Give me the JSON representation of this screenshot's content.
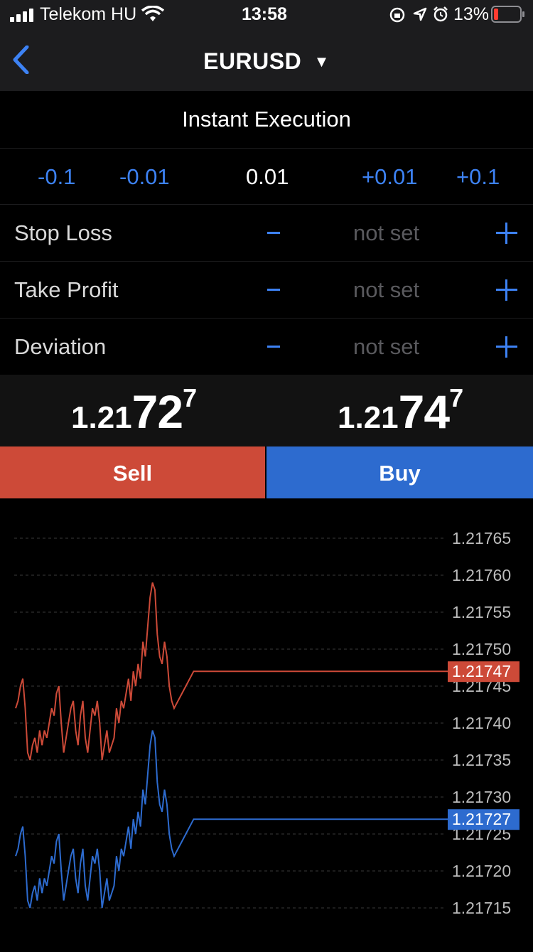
{
  "status_bar": {
    "carrier": "Telekom HU",
    "time": "13:58",
    "battery": "13%",
    "icons": [
      "signal-icon",
      "wifi-icon",
      "orientation-lock-icon",
      "location-icon",
      "alarm-icon",
      "battery-icon"
    ]
  },
  "nav": {
    "back_icon": "chevron-left-icon",
    "title": "EURUSD",
    "dropdown_icon": "caret-down-icon"
  },
  "execution_mode": "Instant Execution",
  "volume": {
    "dec_large": "-0.1",
    "dec_small": "-0.01",
    "value": "0.01",
    "inc_small": "+0.01",
    "inc_large": "+0.1"
  },
  "params": [
    {
      "label": "Stop Loss",
      "value": "not set"
    },
    {
      "label": "Take Profit",
      "value": "not set"
    },
    {
      "label": "Deviation",
      "value": "not set"
    }
  ],
  "quotes": {
    "sell": {
      "prefix": "1.21",
      "big": "72",
      "sup": "7"
    },
    "buy": {
      "prefix": "1.21",
      "big": "74",
      "sup": "7"
    }
  },
  "buttons": {
    "sell": "Sell",
    "buy": "Buy"
  },
  "colors": {
    "sell": "#cd4a38",
    "buy": "#2d6bcf",
    "accent": "#3d82f4"
  },
  "chart_data": {
    "type": "line",
    "ylim": [
      1.21712,
      1.21768
    ],
    "y_ticks": [
      "1.21765",
      "1.21760",
      "1.21755",
      "1.21750",
      "1.21745",
      "1.21740",
      "1.21735",
      "1.21730",
      "1.21725",
      "1.21720",
      "1.21715"
    ],
    "grid": true,
    "series": [
      {
        "role": "ask",
        "color": "#cd4a38",
        "current_label": "1.21747",
        "values": [
          1.21742,
          1.21743,
          1.21745,
          1.21746,
          1.21742,
          1.21736,
          1.21735,
          1.21737,
          1.21738,
          1.21736,
          1.21739,
          1.21737,
          1.21739,
          1.21738,
          1.2174,
          1.21742,
          1.21741,
          1.21744,
          1.21745,
          1.2174,
          1.21736,
          1.21738,
          1.2174,
          1.21742,
          1.21743,
          1.21739,
          1.21737,
          1.21741,
          1.21743,
          1.21738,
          1.21736,
          1.21739,
          1.21742,
          1.21741,
          1.21743,
          1.2174,
          1.21735,
          1.21737,
          1.21739,
          1.21736,
          1.21737,
          1.21738,
          1.21742,
          1.2174,
          1.21743,
          1.21742,
          1.21744,
          1.21746,
          1.21743,
          1.21747,
          1.21745,
          1.21748,
          1.21746,
          1.21751,
          1.21749,
          1.21753,
          1.21757,
          1.21759,
          1.21758,
          1.21752,
          1.21749,
          1.21748,
          1.21751,
          1.21749,
          1.21745,
          1.21743,
          1.21742,
          1.21747,
          1.21747,
          1.21747,
          1.21747,
          1.21747,
          1.21747,
          1.21747,
          1.21747,
          1.21747,
          1.21747,
          1.21747,
          1.21747,
          1.21747,
          1.21747
        ]
      },
      {
        "role": "bid",
        "color": "#2d6bcf",
        "current_label": "1.21727",
        "values": [
          1.21722,
          1.21723,
          1.21725,
          1.21726,
          1.21722,
          1.21716,
          1.21715,
          1.21717,
          1.21718,
          1.21716,
          1.21719,
          1.21717,
          1.21719,
          1.21718,
          1.2172,
          1.21722,
          1.21721,
          1.21724,
          1.21725,
          1.2172,
          1.21716,
          1.21718,
          1.2172,
          1.21722,
          1.21723,
          1.21719,
          1.21717,
          1.21721,
          1.21723,
          1.21718,
          1.21716,
          1.21719,
          1.21722,
          1.21721,
          1.21723,
          1.2172,
          1.21715,
          1.21717,
          1.21719,
          1.21716,
          1.21717,
          1.21718,
          1.21722,
          1.2172,
          1.21723,
          1.21722,
          1.21724,
          1.21726,
          1.21723,
          1.21727,
          1.21725,
          1.21728,
          1.21726,
          1.21731,
          1.21729,
          1.21733,
          1.21737,
          1.21739,
          1.21738,
          1.21732,
          1.21729,
          1.21728,
          1.21731,
          1.21729,
          1.21725,
          1.21723,
          1.21722,
          1.21727,
          1.21727,
          1.21727,
          1.21727,
          1.21727,
          1.21727,
          1.21727,
          1.21727,
          1.21727,
          1.21727,
          1.21727,
          1.21727,
          1.21727,
          1.21727
        ]
      }
    ]
  }
}
